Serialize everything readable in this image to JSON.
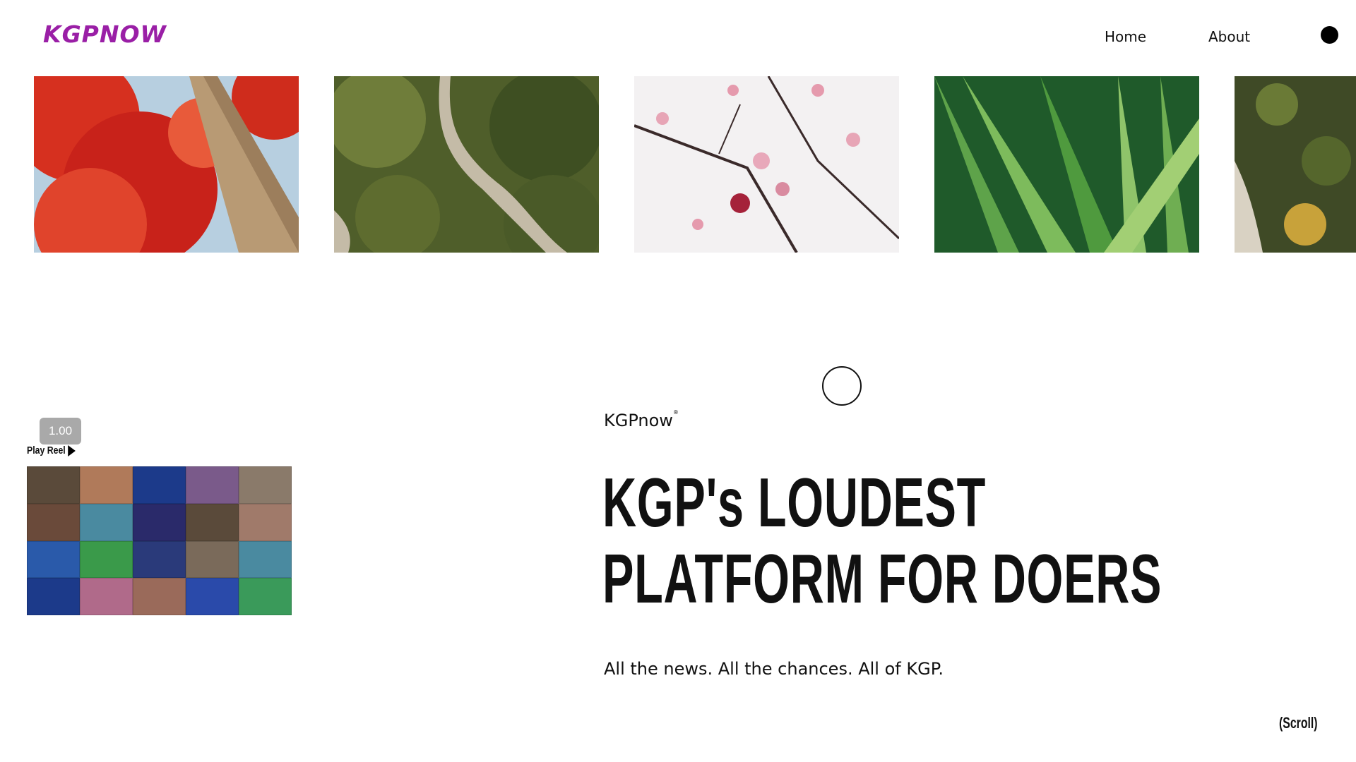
{
  "header": {
    "logo_text": "KGPNOW",
    "logo_color": "#9a1fa6",
    "logo_accent": "#c4309b",
    "nav": {
      "home": "Home",
      "about": "About"
    },
    "menu_icon": "menu-dot-icon"
  },
  "gallery": {
    "images": [
      {
        "subject": "red-foliage-tree"
      },
      {
        "subject": "aerial-forest-road"
      },
      {
        "subject": "cherry-blossom-branch"
      },
      {
        "subject": "palm-fronds"
      },
      {
        "subject": "aerial-coastal-trees"
      }
    ]
  },
  "reel": {
    "playback_rate": "1.00",
    "play_label": "Play Reel",
    "play_icon": "play-triangle-icon"
  },
  "hero": {
    "brand": "KGPnow",
    "brand_mark": "®",
    "headline_line1": "KGP's LOUDEST",
    "headline_line2": "PLATFORM FOR DOERS",
    "tagline": "All the news. All the chances. All of KGP."
  },
  "scroll_hint": "(Scroll)"
}
